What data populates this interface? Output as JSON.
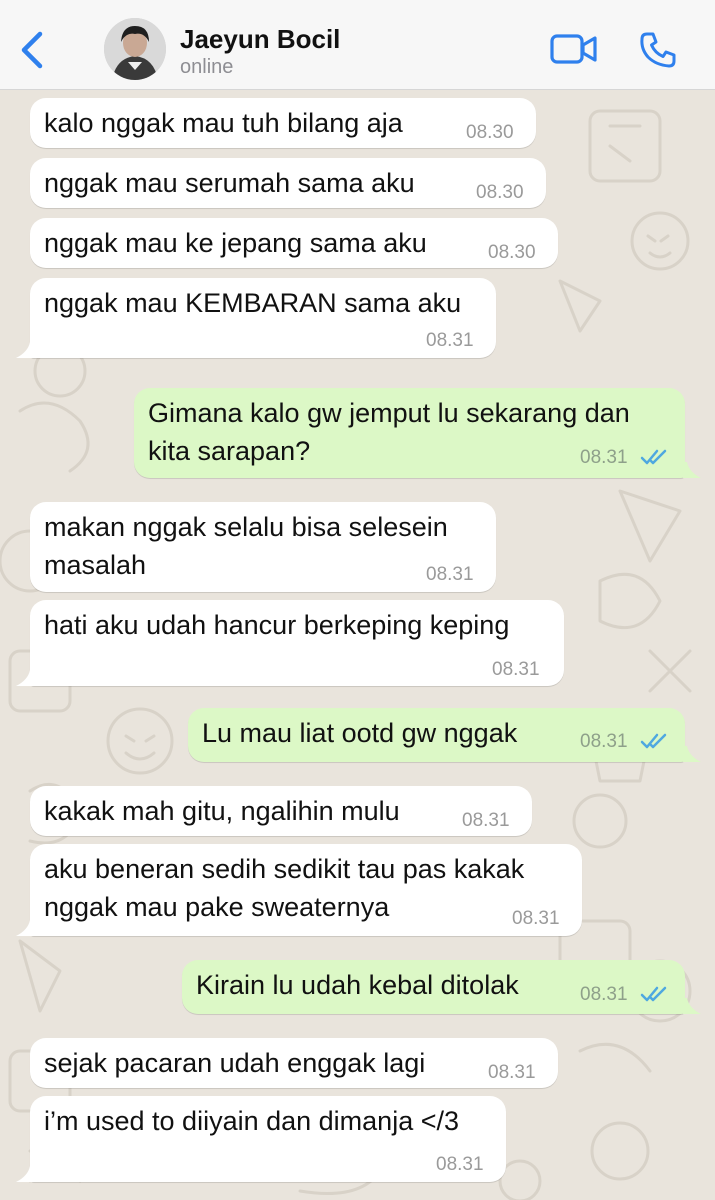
{
  "header": {
    "contact_name": "Jaeyun Bocil",
    "status": "online",
    "icons": [
      "chevron-left-icon",
      "video-camera-icon",
      "phone-icon"
    ],
    "accent_color": "#2f80ed"
  },
  "messages": [
    {
      "direction": "in",
      "text": "kalo nggak mau tuh bilang aja",
      "time": "08.30"
    },
    {
      "direction": "in",
      "text": "nggak mau serumah sama aku",
      "time": "08.30"
    },
    {
      "direction": "in",
      "text": "nggak mau ke jepang sama aku",
      "time": "08.30"
    },
    {
      "direction": "in",
      "text": "nggak mau KEMBARAN sama aku",
      "time": "08.31"
    },
    {
      "direction": "out",
      "text": "Gimana kalo gw jemput lu sekarang dan\nkita sarapan?",
      "time": "08.31",
      "read": true
    },
    {
      "direction": "in",
      "text": "makan nggak selalu bisa selesein\nmasalah",
      "time": "08.31"
    },
    {
      "direction": "in",
      "text": "hati aku udah hancur berkeping keping",
      "time": "08.31"
    },
    {
      "direction": "out",
      "text": "Lu mau liat ootd gw nggak",
      "time": "08.31",
      "read": true
    },
    {
      "direction": "in",
      "text": "kakak mah gitu, ngalihin mulu",
      "time": "08.31"
    },
    {
      "direction": "in",
      "text": "aku beneran sedih sedikit tau pas kakak\nnggak mau pake sweaternya",
      "time": "08.31"
    },
    {
      "direction": "out",
      "text": "Kirain lu udah kebal ditolak",
      "time": "08.31",
      "read": true
    },
    {
      "direction": "in",
      "text": "sejak pacaran udah enggak lagi",
      "time": "08.31"
    },
    {
      "direction": "in",
      "text": "i’m used to diiyain dan dimanja </3",
      "time": "08.31"
    }
  ],
  "colors": {
    "incoming_bubble": "#ffffff",
    "outgoing_bubble": "#dcf8c6",
    "read_ticks": "#4fa8e0",
    "chat_background": "#e9e4dc"
  }
}
